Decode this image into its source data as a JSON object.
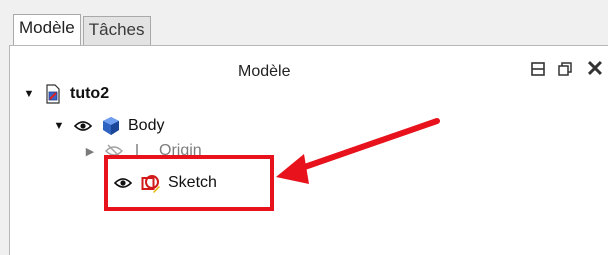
{
  "tabs": [
    {
      "label": "Modèle",
      "active": true
    },
    {
      "label": "Tâches",
      "active": false
    }
  ],
  "panel": {
    "title": "Modèle"
  },
  "tree": {
    "root": {
      "label": "tuto2",
      "icon": "document-icon",
      "expanded": true
    },
    "body": {
      "label": "Body",
      "icon": "body-cube-icon",
      "visible": true,
      "expanded": true
    },
    "origin": {
      "label": "Origin",
      "icon": "axis-icon",
      "visible": false,
      "expanded": false
    },
    "sketch": {
      "label": "Sketch",
      "icon": "sketch-icon",
      "visible": true
    }
  },
  "annotation": {
    "color": "#e8121c"
  }
}
